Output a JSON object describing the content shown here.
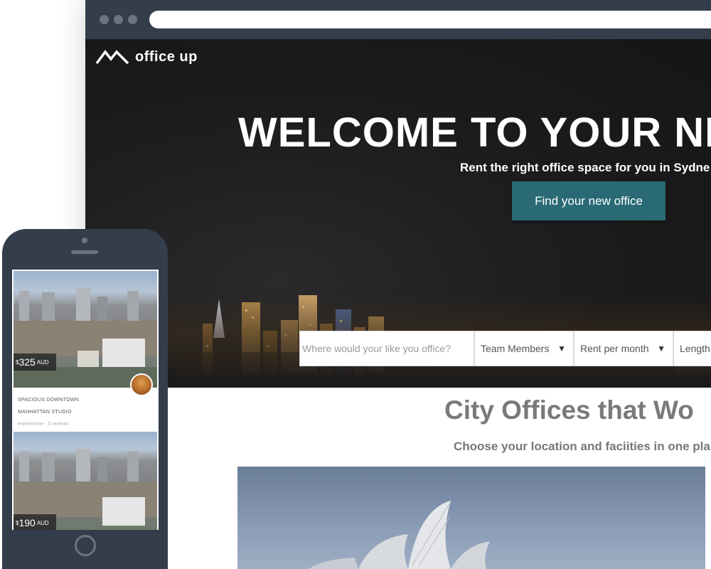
{
  "brand": {
    "name": "office up"
  },
  "hero": {
    "title": "WELCOME TO YOUR NE",
    "subtitle": "Rent the right office space for you in Sydne",
    "cta_label": "Find your new office"
  },
  "search": {
    "placeholder": "Where would your like you office?",
    "filters": [
      {
        "label": "Team Members",
        "arrow": "▼"
      },
      {
        "label": "Rent per month",
        "arrow": "▼"
      },
      {
        "label": "Length",
        "arrow": ""
      }
    ]
  },
  "section": {
    "title": "City Offices that Wo",
    "subtitle": "Choose your location and faciities in one pla"
  },
  "mobile": {
    "listings": [
      {
        "price": "325",
        "currency_prefix": "$",
        "currency": "AUD",
        "title_line1": "SPACIOUS DOWNTOWN",
        "title_line2": "MANHATTAN STUDIO",
        "meta": "entireHome · 5 reviews"
      },
      {
        "price": "190",
        "currency_prefix": "$",
        "currency": "AUD"
      }
    ]
  },
  "colors": {
    "frame": "#343d4b",
    "cta": "#2a6a74",
    "section_title": "#7a7a7a"
  }
}
